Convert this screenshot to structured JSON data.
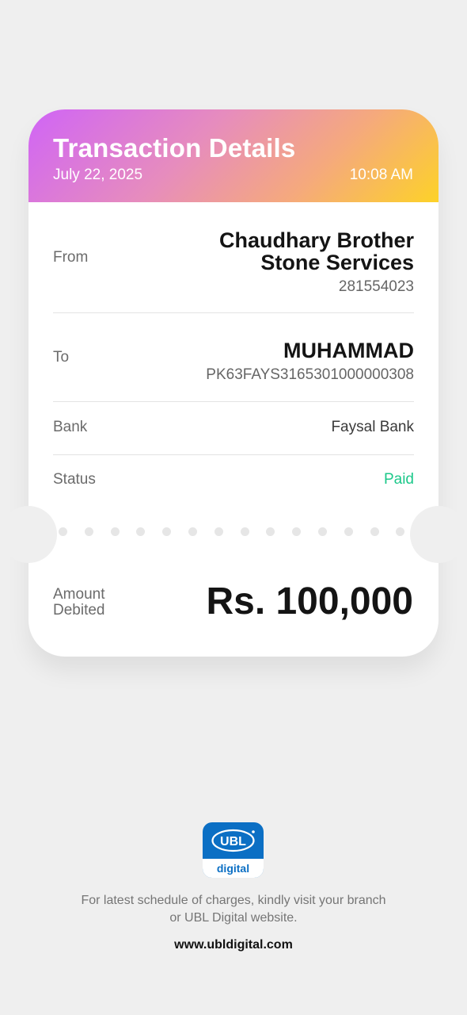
{
  "header": {
    "title": "Transaction Details",
    "date": "July 22, 2025",
    "time": "10:08 AM"
  },
  "from": {
    "label": "From",
    "name_line1": "Chaudhary Brother",
    "name_line2": "Stone Services",
    "account": "281554023"
  },
  "to": {
    "label": "To",
    "name": "MUHAMMAD",
    "account": "PK63FAYS3165301000000308"
  },
  "bank": {
    "label": "Bank",
    "value": "Faysal Bank"
  },
  "status": {
    "label": "Status",
    "value": "Paid",
    "color": "#1cc88a"
  },
  "amount": {
    "label_line1": "Amount",
    "label_line2": "Debited",
    "value": "Rs. 100,000"
  },
  "footer": {
    "logo_text": "UBL",
    "logo_sub": "digital",
    "note_line1": "For latest schedule of charges, kindly visit your branch",
    "note_line2": "or UBL Digital website.",
    "website": "www.ubldigital.com"
  }
}
